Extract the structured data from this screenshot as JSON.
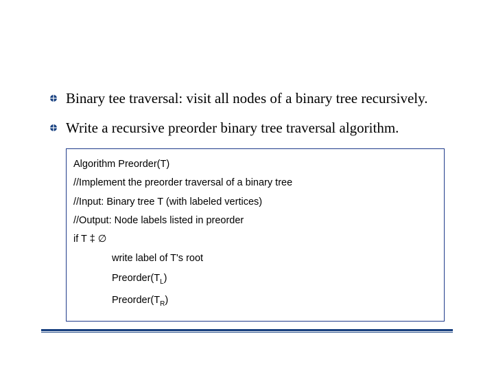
{
  "bullets": [
    "Binary tee traversal: visit all nodes of a binary tree recursively.",
    "Write a recursive preorder binary tree traversal algorithm."
  ],
  "algo": {
    "header": "Algorithm Preorder(T)",
    "comment1": "//Implement the preorder traversal of a binary tree",
    "comment2": "//Input: Binary tree T (with labeled vertices)",
    "comment3": "//Output: Node labels listed in preorder",
    "ifline_prefix": "if T ",
    "ifline_neq": "‡",
    "ifline_empty": " ∅",
    "step1": "write label of T's root",
    "step2_pre": "Preorder(T",
    "step2_sub": "L",
    "step2_post": ")",
    "step3_pre": "Preorder(T",
    "step3_sub": "R",
    "step3_post": ")"
  }
}
